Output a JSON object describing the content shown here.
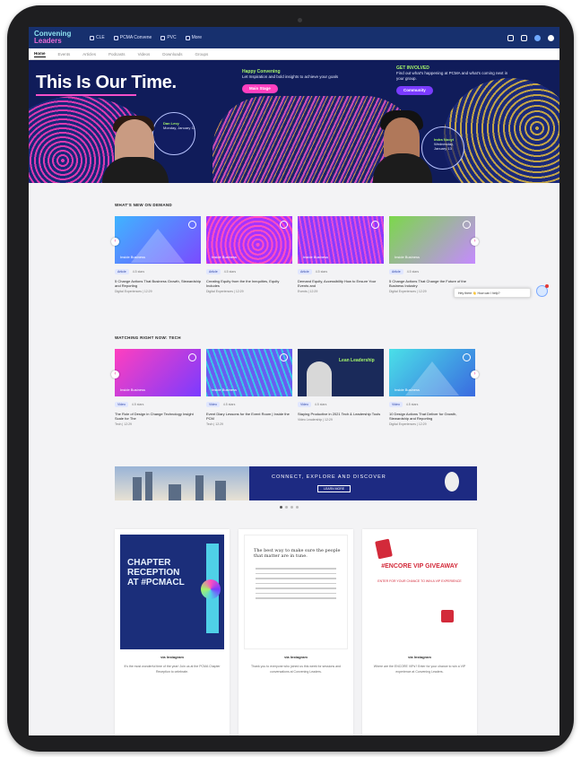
{
  "app": {
    "logo_line1": "Convening",
    "logo_line2": "Leaders"
  },
  "topnav": {
    "links": [
      "CLE",
      "PCMA Convene",
      "PVC",
      "More"
    ]
  },
  "subnav": {
    "items": [
      "Home",
      "Events",
      "Articles",
      "Podcasts",
      "Videos",
      "Downloads",
      "Groups"
    ],
    "active": "Home"
  },
  "hero": {
    "title": "This Is Our Time.",
    "promo1": {
      "tag": "Happy Convening",
      "text": "Let Inspiration and bold insights to achieve your goals",
      "button": "Main Stage"
    },
    "promo2": {
      "tag": "GET INVOLVED",
      "text": "Find out what's happening at PCMA and what's coming next in your group.",
      "button": "Community"
    },
    "speaker1": {
      "name": "Dan Levy",
      "time": "Monday, January 11"
    },
    "speaker2": {
      "name": "Indra Nooyi",
      "time": "Wednesday, January 13"
    }
  },
  "section1": {
    "title": "WHAT'S NEW ON DEMAND",
    "cards": [
      {
        "label": "Inside Business",
        "tag": "Article",
        "rating": "4.5 stars",
        "title": "5 Change Actions That Business Growth, Stewardship and Reporting",
        "sub": "Digital Experiences  |  12:29"
      },
      {
        "label": "Inside Business",
        "tag": "Article",
        "rating": "4.5 stars",
        "title": "Creating Equity from the the Inequities, Equity Includes",
        "sub": "Digital Experiences  |  12:29"
      },
      {
        "label": "Inside Business",
        "tag": "Article",
        "rating": "4.5 stars",
        "title": "Demand Equity, Accessibility How to Ensure Your Events and",
        "sub": "Events  |  12:29"
      },
      {
        "label": "Inside Business",
        "tag": "Article",
        "rating": "4.5 stars",
        "title": "5 Change Actions That Change the Future of the Business Industry",
        "sub": "Digital Experiences  |  12:29"
      }
    ]
  },
  "section2": {
    "title": "WATCHING RIGHT NOW: TECH",
    "cards": [
      {
        "label": "Inside Business",
        "tag": "Video",
        "rating": "4.5 stars",
        "title": "The Role of Design in Change Technology Insight Scale for The",
        "sub": "Tech  |  12:29"
      },
      {
        "label": "Inside Business",
        "tag": "Video",
        "rating": "4.5 stars",
        "title": "Event Diary Lessons for the Event Room  |  Inside the PCM",
        "sub": "Tech  |  12:29"
      },
      {
        "label": "Lean Leadership",
        "tag": "Video",
        "rating": "4.5 stars",
        "title": "Staying Productive in 2021 Tech & Leadership Tools",
        "sub": "Video Leadership  |  12:29"
      },
      {
        "label": "Inside Business",
        "tag": "Video",
        "rating": "4.5 stars",
        "title": "10 Design Actions That Deliver for Growth, Stewardship and Reporting",
        "sub": "Digital Experiences  |  12:29"
      }
    ]
  },
  "tooltip": {
    "text": "Hey there 👋 How can I help?"
  },
  "banner": {
    "headline": "CONNECT, EXPLORE AND DISCOVER",
    "button": "LEARN MORE"
  },
  "posts": [
    {
      "heading": "CHAPTER RECEPTION AT #PCMACL",
      "source": "via Instagram",
      "caption": "It's the most wonderful time of the year! Join us at the PCMA Chapter Reception to celebrate."
    },
    {
      "heading": "The best way to make sure the people that matter are in tune.",
      "source": "via Instagram",
      "caption": "Thank you to everyone who joined us this week for sessions and conversations at Convening Leaders."
    },
    {
      "heading": "#ENCORE VIP GIVEAWAY",
      "subheading": "ENTER FOR YOUR CHANCE TO WIN A VIP EXPERIENCE",
      "source": "via Instagram",
      "caption": "Where are the ENCORE VIPs? Enter for your chance to win a VIP experience at Convening Leaders."
    }
  ],
  "colors": {
    "nav_bg": "#17306e",
    "accent_pink": "#ff3fbf",
    "accent_green": "#a4f36a",
    "banner_bg": "#1d2a82"
  }
}
